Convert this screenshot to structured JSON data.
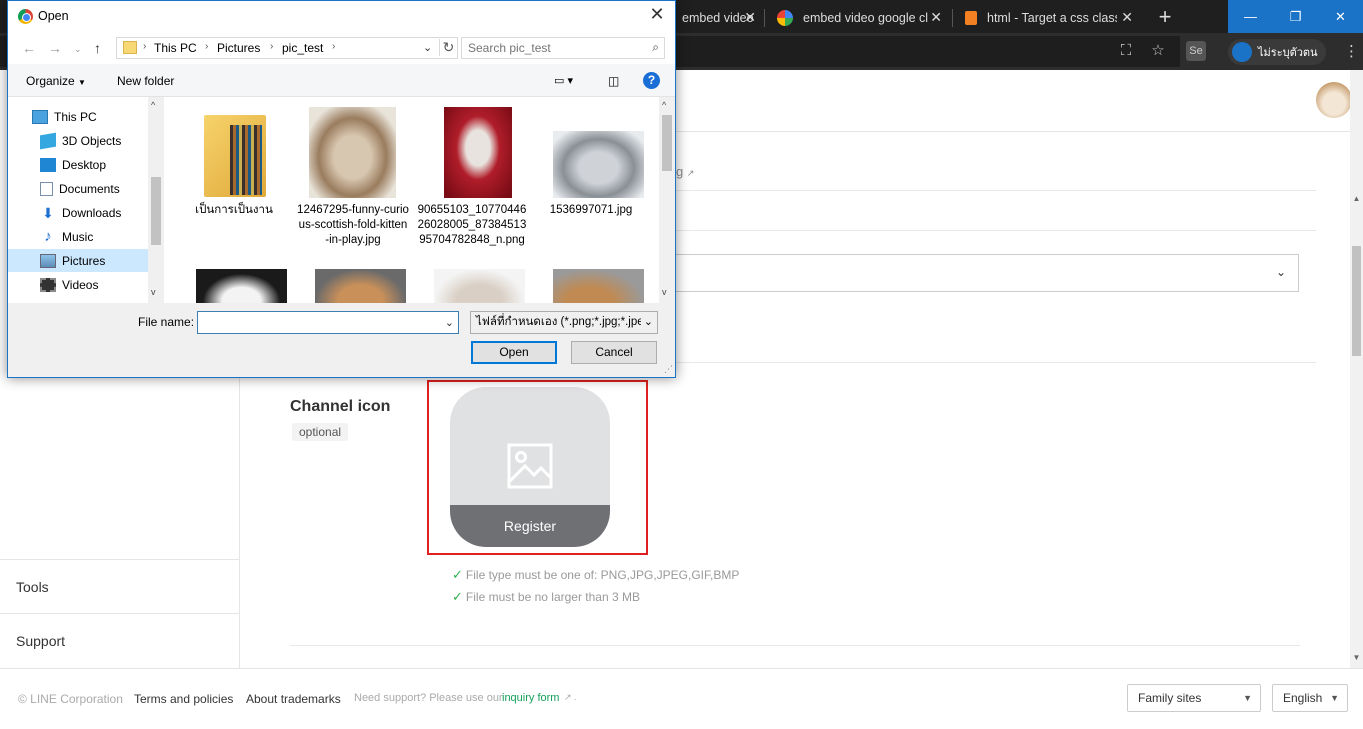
{
  "browser": {
    "tabs": [
      {
        "label": "embed video"
      },
      {
        "label": "embed video google cl"
      },
      {
        "label": "html - Target a css class"
      }
    ],
    "window_controls": [
      "—",
      "❐",
      "✕"
    ],
    "profile_label": "ไม่ระบุตัวตน"
  },
  "dialog": {
    "title": "Open",
    "breadcrumb": [
      "This PC",
      "Pictures",
      "pic_test"
    ],
    "search_placeholder": "Search pic_test",
    "organize_label": "Organize",
    "new_folder_label": "New folder",
    "help_label": "?",
    "tree": [
      {
        "label": "This PC",
        "icon": "computer-icon"
      },
      {
        "label": "3D Objects",
        "icon": "cube-icon"
      },
      {
        "label": "Desktop",
        "icon": "desktop-icon"
      },
      {
        "label": "Documents",
        "icon": "document-icon"
      },
      {
        "label": "Downloads",
        "icon": "download-icon"
      },
      {
        "label": "Music",
        "icon": "music-icon"
      },
      {
        "label": "Pictures",
        "icon": "pictures-icon"
      },
      {
        "label": "Videos",
        "icon": "video-icon"
      }
    ],
    "files": [
      {
        "name": "เป็นการเป็นงาน"
      },
      {
        "name": "12467295-funny-curious-scottish-fold-kitten-in-play.jpg"
      },
      {
        "name": "90655103_1077044626028005_8738451395704782848_n.png"
      },
      {
        "name": "1536997071.jpg"
      }
    ],
    "file_name_label": "File name:",
    "file_name_value": "",
    "file_type_value": "ไฟล์ที่กำหนดเอง (*.png;*.jpg;*.jpe",
    "open_label": "Open",
    "cancel_label": "Cancel"
  },
  "page": {
    "nav": [
      {
        "label": "Tools"
      },
      {
        "label": "Support"
      }
    ],
    "link_fragment": "g",
    "channel_icon_label": "Channel icon",
    "optional_label": "optional",
    "register_label": "Register",
    "requirements": [
      "File type must be one of: PNG,JPG,JPEG,GIF,BMP",
      "File must be no larger than 3 MB"
    ]
  },
  "footer": {
    "copyright": "© LINE Corporation",
    "terms": "Terms and policies",
    "trademarks": "About trademarks",
    "support_text": "Need support? Please use our",
    "inquiry_link": "inquiry form",
    "family_sites": "Family sites",
    "language": "English"
  },
  "colors": {
    "highlight": "#e02020",
    "check": "#2fb04a",
    "link_green": "#14a05a",
    "title_blue": "#1a73c7"
  }
}
